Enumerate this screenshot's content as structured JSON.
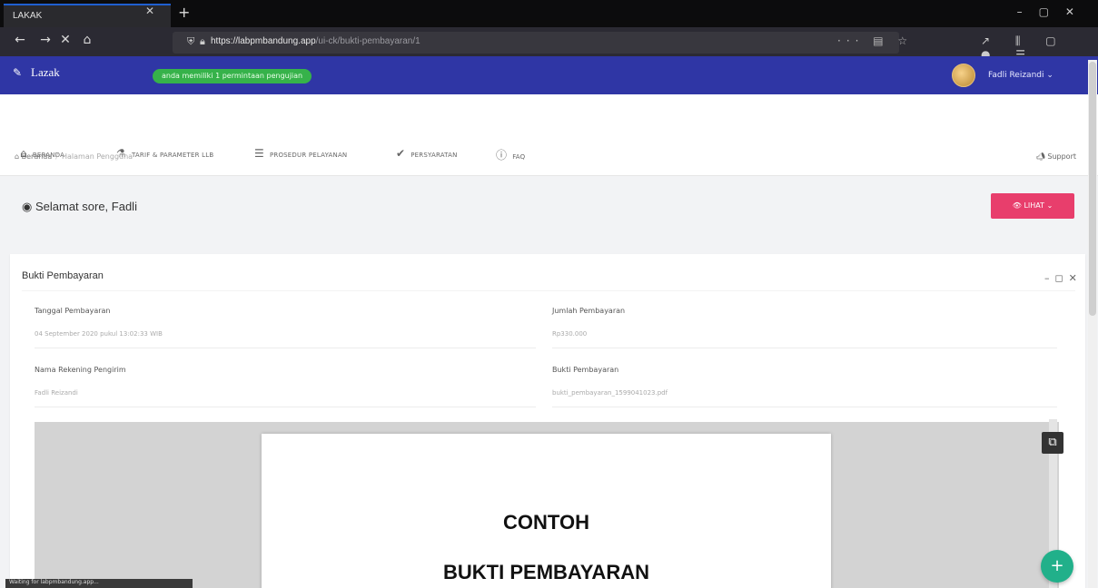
{
  "browser": {
    "tab_title": "LAKAK",
    "url_domain": "https://labpmbandung.app",
    "url_path": "/ui-ck/bukti-pembayaran/1"
  },
  "app": {
    "logo": "Lazak",
    "status_pill": "anda memiliki 1 permintaan pengujian",
    "user_name": "Fadli Reizandi"
  },
  "menu": {
    "items": [
      {
        "label": "BERANDA",
        "icon": "home-icon"
      },
      {
        "label": "TARIF & PARAMETER LLB",
        "icon": "flask-icon"
      },
      {
        "label": "PROSEDUR PELAYANAN",
        "icon": "list-icon"
      },
      {
        "label": "PERSYARATAN",
        "icon": "check-icon"
      },
      {
        "label": "FAQ",
        "icon": "question-icon"
      }
    ]
  },
  "breadcrumb": {
    "home": "Beranda",
    "current": "Halaman Pengguna"
  },
  "support_label": "Support",
  "greeting": "Selamat sore, Fadli",
  "lihat_label": "LIHAT",
  "card": {
    "title": "Bukti Pembayaran",
    "fields": {
      "tanggal_label": "Tanggal Pembayaran",
      "tanggal_value": "04 September 2020 pukul 13:02:33 WIB",
      "jumlah_label": "Jumlah Pembayaran",
      "jumlah_value": "Rp330.000",
      "rekening_label": "Nama Rekening Pengirim",
      "rekening_value": "Fadli Reizandi",
      "bukti_label": "Bukti Pembayaran",
      "bukti_value": "bukti_pembayaran_1599041023.pdf"
    }
  },
  "pdf": {
    "line1": "CONTOH",
    "line2": "BUKTI PEMBAYARAN"
  },
  "status_strip": "Waiting for labpmbandung.app..."
}
